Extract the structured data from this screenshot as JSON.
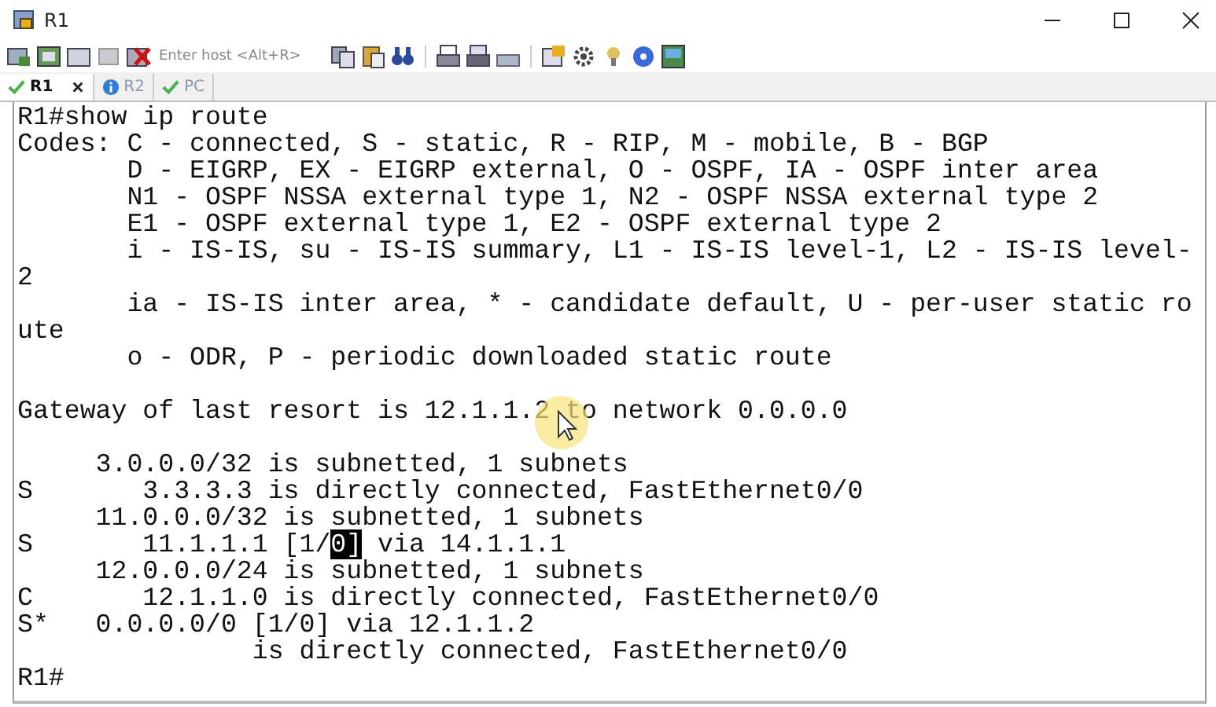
{
  "window": {
    "title": "R1"
  },
  "toolbar": {
    "host_field": {
      "placeholder": "Enter host <Alt+R>"
    }
  },
  "tabs": [
    {
      "label": "R1",
      "kind": "ok",
      "selected": true,
      "closable": true
    },
    {
      "label": "R2",
      "kind": "info",
      "selected": false,
      "closable": false
    },
    {
      "label": "PC",
      "kind": "ok",
      "selected": false,
      "closable": false
    }
  ],
  "terminal": {
    "lines": [
      {
        "kind": "plain",
        "text": "R1#show ip route"
      },
      {
        "kind": "plain",
        "text": "Codes: C - connected, S - static, R - RIP, M - mobile, B - BGP"
      },
      {
        "kind": "plain",
        "text": "       D - EIGRP, EX - EIGRP external, O - OSPF, IA - OSPF inter area"
      },
      {
        "kind": "plain",
        "text": "       N1 - OSPF NSSA external type 1, N2 - OSPF NSSA external type 2"
      },
      {
        "kind": "plain",
        "text": "       E1 - OSPF external type 1, E2 - OSPF external type 2"
      },
      {
        "kind": "plain",
        "text": "       i - IS-IS, su - IS-IS summary, L1 - IS-IS level-1, L2 - IS-IS level-"
      },
      {
        "kind": "plain",
        "text": "2"
      },
      {
        "kind": "plain",
        "text": "       ia - IS-IS inter area, * - candidate default, U - per-user static ro"
      },
      {
        "kind": "plain",
        "text": "ute"
      },
      {
        "kind": "plain",
        "text": "       o - ODR, P - periodic downloaded static route"
      },
      {
        "kind": "blank"
      },
      {
        "kind": "plain",
        "text": "Gateway of last resort is 12.1.1.2 to network 0.0.0.0"
      },
      {
        "kind": "blank"
      },
      {
        "kind": "plain",
        "text": "     3.0.0.0/32 is subnetted, 1 subnets"
      },
      {
        "kind": "plain",
        "text": "S       3.3.3.3 is directly connected, FastEthernet0/0"
      },
      {
        "kind": "plain",
        "text": "     11.0.0.0/32 is subnetted, 1 subnets"
      },
      {
        "kind": "highlight",
        "before": "S       11.1.1.1 [1/",
        "mark": "0]",
        "after": " via 14.1.1.1"
      },
      {
        "kind": "plain",
        "text": "     12.0.0.0/24 is subnetted, 1 subnets"
      },
      {
        "kind": "plain",
        "text": "C       12.1.1.0 is directly connected, FastEthernet0/0"
      },
      {
        "kind": "plain",
        "text": "S*   0.0.0.0/0 [1/0] via 12.1.1.2"
      },
      {
        "kind": "plain",
        "text": "               is directly connected, FastEthernet0/0"
      },
      {
        "kind": "plain",
        "text": "R1#"
      }
    ]
  }
}
